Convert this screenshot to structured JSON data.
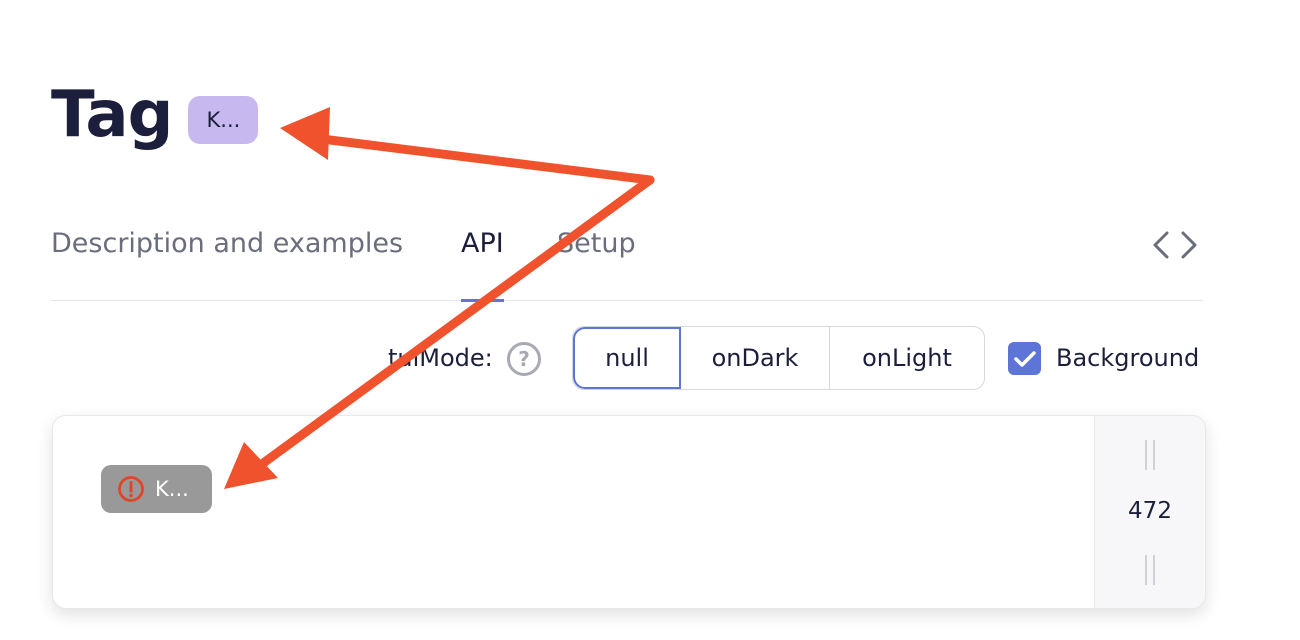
{
  "header": {
    "title": "Tag",
    "badge_text": "K..."
  },
  "tabs": [
    {
      "label": "Description and examples",
      "active": false
    },
    {
      "label": "API",
      "active": true
    },
    {
      "label": "Setup",
      "active": false
    }
  ],
  "code_toggle_icon": "code-brackets-icon",
  "controls": {
    "mode_label": "tuiMode:",
    "help_icon": "question-circle-icon",
    "mode_options": [
      "null",
      "onDark",
      "onLight"
    ],
    "selected_mode": "null",
    "background_label": "Background",
    "background_checked": true
  },
  "demo": {
    "tag_text": "K...",
    "tag_icon": "error-circle-icon",
    "width_value": "472"
  },
  "colors": {
    "accent": "#5c75d6",
    "badge_bg": "#c7b8ef",
    "demo_tag_bg": "#999999",
    "error_icon": "#e0452a",
    "annotation_arrow": "#ef522d"
  }
}
